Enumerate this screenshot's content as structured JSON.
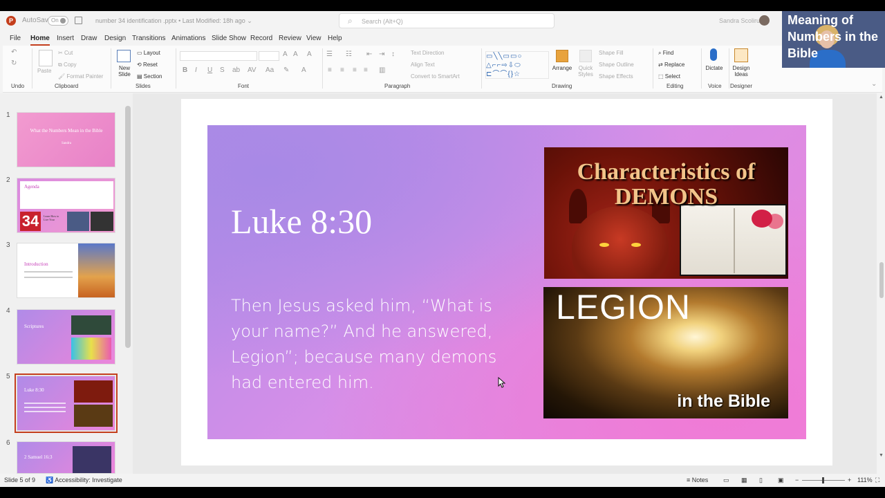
{
  "titlebar": {
    "app_logo": "P",
    "autosave_label": "AutoSave",
    "autosave_state": "On",
    "doc_title": "number 34 identification .pptx • Last Modified: 18h ago ⌄",
    "search_placeholder": "Search (Alt+Q)",
    "user_name": "Sandra Scoliru"
  },
  "menu": [
    "File",
    "Home",
    "Insert",
    "Draw",
    "Design",
    "Transitions",
    "Animations",
    "Slide Show",
    "Record",
    "Review",
    "View",
    "Help"
  ],
  "ribbon": {
    "undo_label": "Undo",
    "clipboard": {
      "paste": "Paste",
      "cut": "Cut",
      "copy": "Copy",
      "format_painter": "Format Painter",
      "label": "Clipboard"
    },
    "slides": {
      "new_slide": "New Slide",
      "layout": "Layout",
      "reset": "Reset",
      "section": "Section",
      "label": "Slides"
    },
    "font": {
      "bold": "B",
      "italic": "I",
      "underline": "U",
      "strike": "S",
      "label": "Font"
    },
    "paragraph": {
      "text_direction": "Text Direction",
      "align_text": "Align Text",
      "smartart": "Convert to SmartArt",
      "label": "Paragraph"
    },
    "drawing": {
      "arrange": "Arrange",
      "quick_styles": "Quick Styles",
      "shape_fill": "Shape Fill",
      "shape_outline": "Shape Outline",
      "shape_effects": "Shape Effects",
      "label": "Drawing"
    },
    "editing": {
      "find": "Find",
      "replace": "Replace",
      "select": "Select",
      "label": "Editing"
    },
    "voice": {
      "dictate": "Dictate",
      "label": "Voice"
    },
    "designer": {
      "design_ideas": "Design Ideas",
      "label": "Designer"
    }
  },
  "thumbnails": [
    {
      "num": "1",
      "title": "What the Numbers Mean in the Bible",
      "sub": "Sandra"
    },
    {
      "num": "2",
      "title": "Agenda",
      "badge": "34",
      "sub": "Learn How to Live Your"
    },
    {
      "num": "3",
      "title": "Introduction"
    },
    {
      "num": "4",
      "title": "Scriptures"
    },
    {
      "num": "5",
      "title": "Luke 8:30"
    },
    {
      "num": "6",
      "title": "2 Samuel 16:3"
    }
  ],
  "slide": {
    "title": "Luke 8:30",
    "body": "Then Jesus asked him, “What is your name?” And he answered, Legion”; because many demons had entered him.",
    "image1_text": "Characteristics of DEMONS",
    "image2_title": "LEGION",
    "image2_sub": "in the Bible"
  },
  "webcam_overlay": "Meaning of Numbers in the Bible",
  "statusbar": {
    "slide_info": "Slide 5 of 9",
    "accessibility": "Accessibility: Investigate",
    "notes": "Notes",
    "zoom": "111%"
  }
}
